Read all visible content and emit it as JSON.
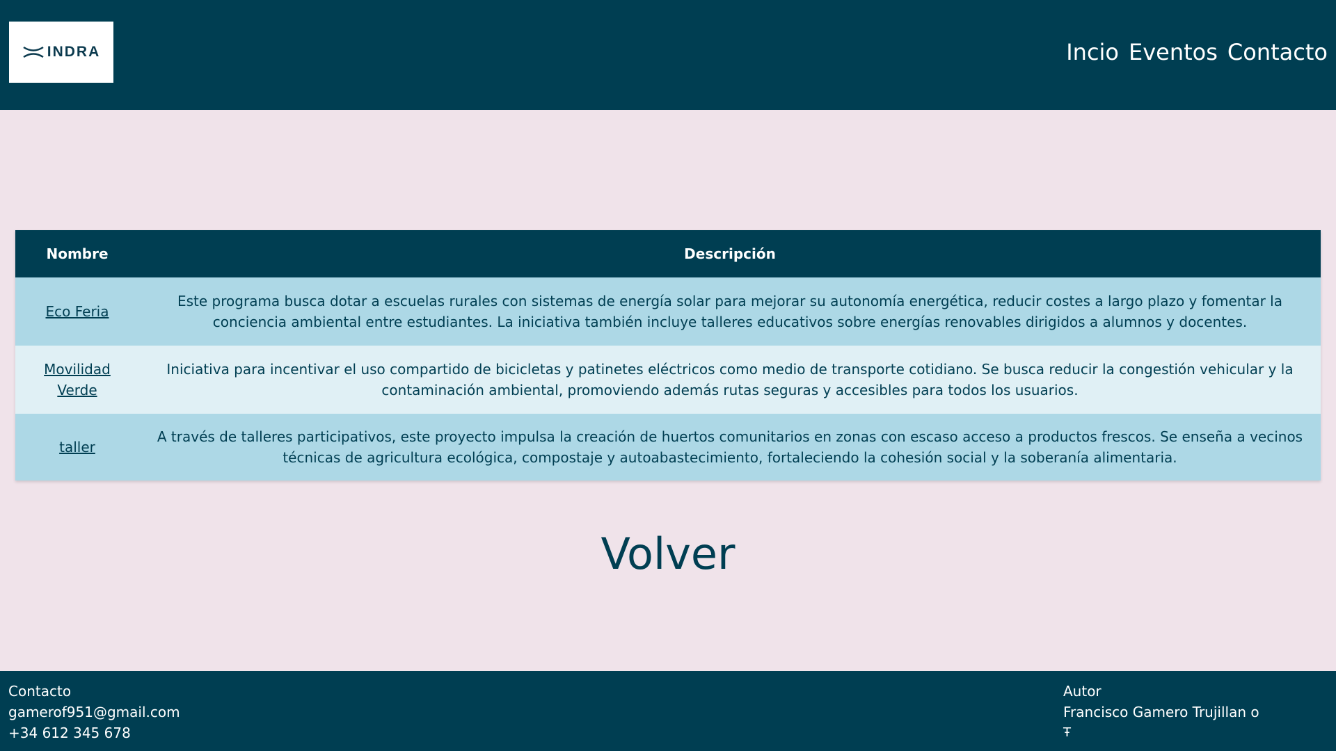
{
  "header": {
    "logo_text": "INDRA",
    "nav": [
      {
        "label": "Incio"
      },
      {
        "label": "Eventos"
      },
      {
        "label": "Contacto"
      }
    ]
  },
  "table": {
    "headers": {
      "name": "Nombre",
      "description": "Descripción"
    },
    "rows": [
      {
        "name": "Eco Feria",
        "description": "Este programa busca dotar a escuelas rurales con sistemas de energía solar para mejorar su autonomía energética, reducir costes a largo plazo y fomentar la conciencia ambiental entre estudiantes. La iniciativa también incluye talleres educativos sobre energías renovables dirigidos a alumnos y docentes."
      },
      {
        "name": "Movilidad Verde",
        "description": "Iniciativa para incentivar el uso compartido de bicicletas y patinetes eléctricos como medio de transporte cotidiano. Se busca reducir la congestión vehicular y la contaminación ambiental, promoviendo además rutas seguras y accesibles para todos los usuarios."
      },
      {
        "name": "taller",
        "description": "A través de talleres participativos, este proyecto impulsa la creación de huertos comunitarios en zonas con escaso acceso a productos frescos. Se enseña a vecinos técnicas de agricultura ecológica, compostaje y autoabastecimiento, fortaleciendo la cohesión social y la soberanía alimentaria."
      }
    ]
  },
  "volver_label": "Volver",
  "footer": {
    "contact": {
      "title": "Contacto",
      "email": "gamerof951@gmail.com",
      "phone": "+34 612 345 678"
    },
    "author": {
      "title": "Autor",
      "name": "Francisco Gamero Trujillan o",
      "glyph": "Ŧ"
    }
  },
  "colors": {
    "primary": "#003e52",
    "background": "#f0e3ea",
    "row_odd": "#add8e6",
    "row_even": "#e0f0f5"
  }
}
